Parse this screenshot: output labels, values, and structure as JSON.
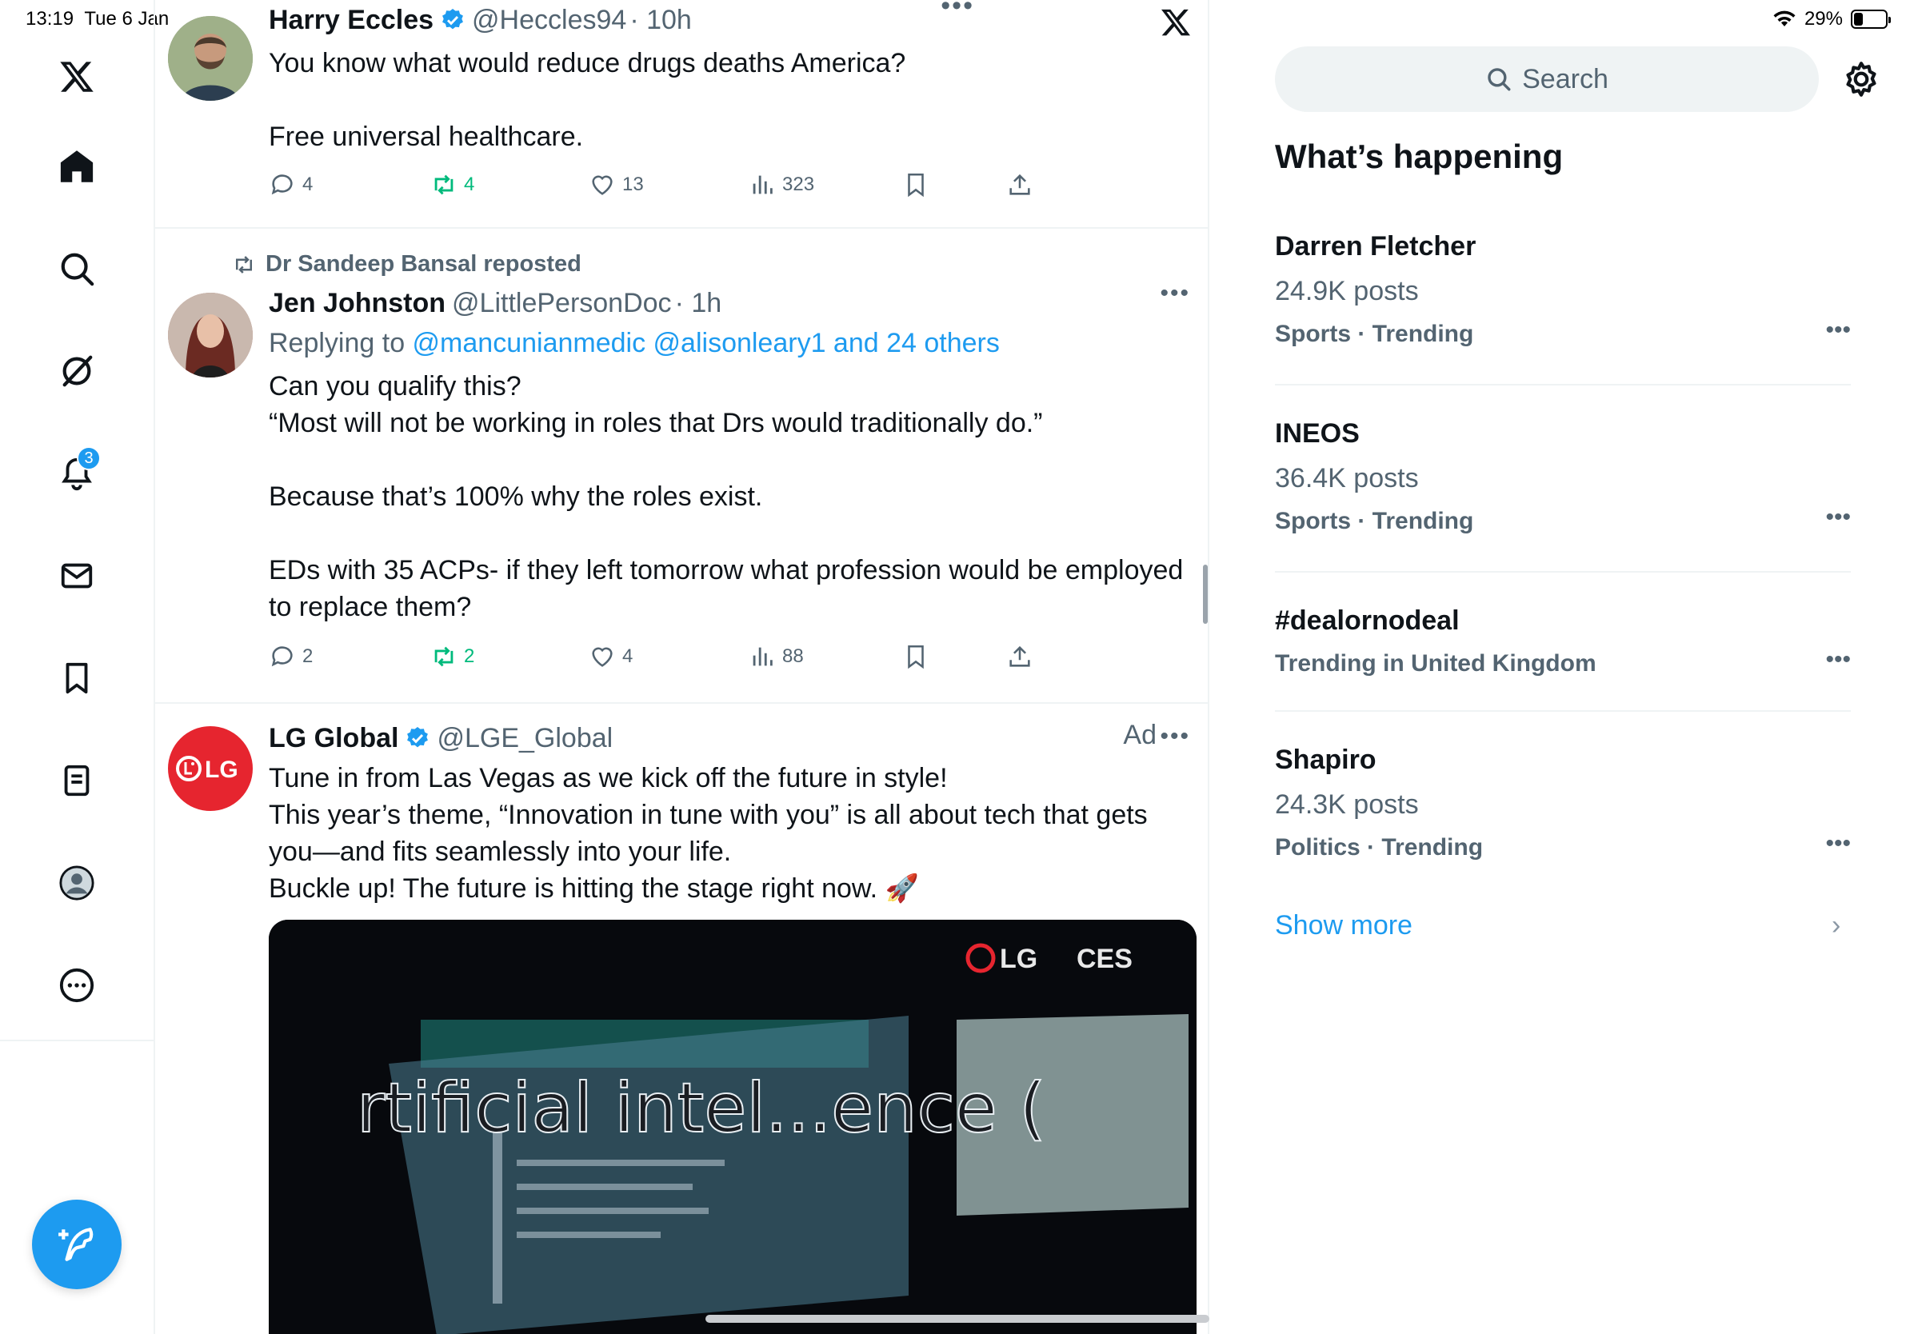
{
  "status_bar": {
    "time": "13:19",
    "date": "Tue 6 Jan",
    "battery": "29%",
    "battery_level": 0.29
  },
  "nav": {
    "items": [
      "x-logo",
      "home",
      "explore",
      "grok",
      "notifications",
      "messages",
      "bookmarks",
      "lists",
      "profile",
      "more"
    ],
    "notifications_badge": "3"
  },
  "tweets": [
    {
      "name": "Harry Eccles",
      "verified": true,
      "handle": "@Heccles94",
      "time": "· 10h",
      "text": "You know what would reduce drugs deaths America?\n\nFree universal healthcare.",
      "replies": "4",
      "reposts": "4",
      "likes": "13",
      "views": "323"
    },
    {
      "reposted_by": "Dr Sandeep Bansal reposted",
      "name": "Jen Johnston",
      "handle": "@LittlePersonDoc",
      "time": "· 1h",
      "replying_prefix": "Replying to ",
      "replying_to": "@mancunianmedic @alisonleary1 and 24 others",
      "text": "Can you qualify this?\n“Most will not be working in roles that Drs would traditionally do.”\n\nBecause that’s 100% why the roles exist.\n\nEDs with 35 ACPs- if they left tomorrow what profession would be employed to replace them?",
      "replies": "2",
      "reposts": "2",
      "likes": "4",
      "views": "88"
    },
    {
      "name": "LG Global",
      "verified": true,
      "handle": "@LGE_Global",
      "ad_label": "Ad",
      "text": "Tune in from Las Vegas as we kick off the future in style!\nThis year’s theme, “Innovation in tune with you” is all about tech that gets you—and fits seamlessly into your life.\nBuckle up! The future is hitting the stage right now. 🚀",
      "media_logo_text": "LG",
      "media_event_text": "CES",
      "media_caption": "rtificial intel...ence ("
    }
  ],
  "sidebar": {
    "search_placeholder": "Search",
    "section_title": "What’s happening",
    "trends": [
      {
        "name": "Darren Fletcher",
        "posts": "24.9K posts",
        "category": "Sports · Trending"
      },
      {
        "name": "INEOS",
        "posts": "36.4K posts",
        "category": "Sports · Trending"
      },
      {
        "name": "#dealornodeal",
        "posts": "",
        "category": "Trending in United Kingdom"
      },
      {
        "name": "Shapiro",
        "posts": "24.3K posts",
        "category": "Politics · Trending"
      }
    ],
    "show_more": "Show more"
  },
  "colors": {
    "accent": "#1d9bf0",
    "muted": "#536471",
    "repost_green": "#00ba7c",
    "border": "#eff3f4",
    "lg_red": "#e6252f"
  }
}
